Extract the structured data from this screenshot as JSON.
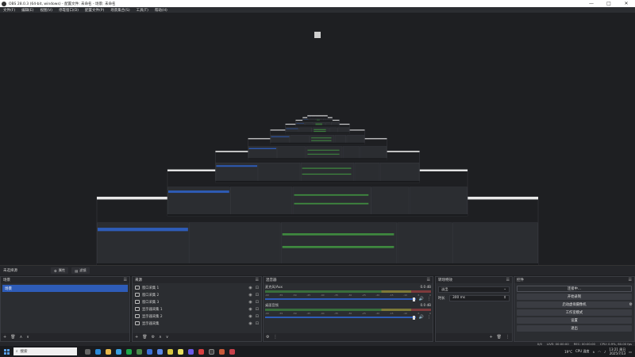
{
  "window": {
    "title": "OBS 28.0.3 (64-bit, windows) - 配置文件: 未命名 - 场景: 未命名",
    "min": "—",
    "max": "□",
    "close": "✕"
  },
  "menu": [
    "文件(F)",
    "编辑(E)",
    "视图(V)",
    "停靠窗口(D)",
    "配置文件(P)",
    "场景集合(S)",
    "工具(T)",
    "帮助(H)"
  ],
  "scene_bar": {
    "label": "未选择源",
    "properties": "属性",
    "filters": "滤镜"
  },
  "scenes": {
    "title": "场景",
    "items": [
      {
        "label": "场景",
        "active": true
      }
    ],
    "footer": [
      "+",
      "🗑",
      "∧",
      "∨"
    ]
  },
  "sources": {
    "title": "来源",
    "items": [
      {
        "label": "窗口采集 1"
      },
      {
        "label": "窗口采集 2"
      },
      {
        "label": "窗口采集 3"
      },
      {
        "label": "显示器采集 1"
      },
      {
        "label": "显示器采集 2"
      },
      {
        "label": "显示器采集"
      }
    ],
    "footer": [
      "+",
      "🗑",
      "⚙",
      "∧",
      "∨"
    ]
  },
  "mixer": {
    "title": "混音器",
    "channels": [
      {
        "name": "麦克风/Aux",
        "db": "0.0 dB"
      },
      {
        "name": "桌面音频",
        "db": "0.0 dB"
      }
    ],
    "scale": [
      "-60",
      "-55",
      "-50",
      "-45",
      "-40",
      "-35",
      "-30",
      "-25",
      "-20",
      "-15",
      "-10",
      "-5",
      "0"
    ]
  },
  "transitions": {
    "title": "转场特效",
    "type": "淡出",
    "duration_label": "时长",
    "duration_value": "300 ms",
    "footer": [
      "+",
      "🗑",
      "⋮"
    ]
  },
  "controls": {
    "title": "控件",
    "buttons": [
      {
        "label": "连接中...",
        "primary": true
      },
      {
        "label": "开始录制"
      },
      {
        "label": "启动虚拟摄像机"
      },
      {
        "label": "工作室模式"
      },
      {
        "label": "设置"
      },
      {
        "label": "退出"
      }
    ]
  },
  "status": {
    "frames": "0/0",
    "live": "LIVE: 00:00:00",
    "rec": "REC: 00:00:00",
    "cpu": "CPU: 0.9%, 60.00 fps"
  },
  "taskbar": {
    "search": "搜索",
    "weather": "19°C",
    "weather_desc": "CPU 温度",
    "time": "13:21 周日",
    "date": "2025/7/13"
  },
  "colors": {
    "accent": "#2e5cb8",
    "panel": "#2b2d31",
    "background": "#1e1f22"
  }
}
